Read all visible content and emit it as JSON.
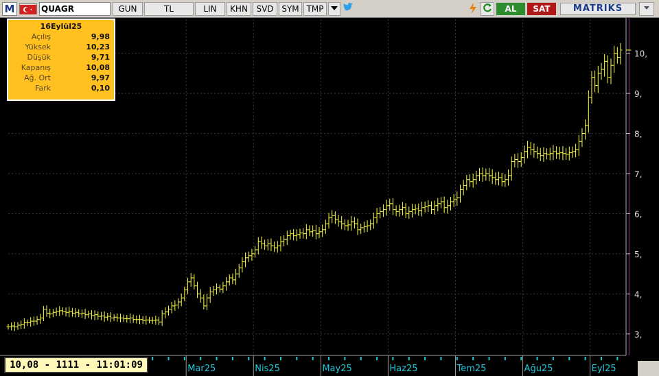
{
  "toolbar": {
    "logo": "M",
    "symbol": "QUAGR",
    "buttons": [
      "GUN",
      "TL",
      "LIN",
      "KHN",
      "SVD",
      "SYM",
      "TMP"
    ],
    "al": "AL",
    "sat": "SAT",
    "brand": "MATRIKS",
    "colors": {
      "al": "#2e8b2e",
      "sat": "#b01818"
    }
  },
  "info": {
    "date": "16Eylül25",
    "rows": [
      {
        "label": "Açılış",
        "value": "9,98"
      },
      {
        "label": "Yüksek",
        "value": "10,23"
      },
      {
        "label": "Düşük",
        "value": "9,71"
      },
      {
        "label": "Kapanış",
        "value": "10,08"
      },
      {
        "label": "Ağ. Ort",
        "value": "9,97"
      },
      {
        "label": "Fark",
        "value": "0,10"
      }
    ]
  },
  "readout": "10,08 - 1111 - 11:01:09",
  "chart_data": {
    "type": "ohlc",
    "color": "#ffff40",
    "ylim": [
      2.5,
      10.85
    ],
    "yticks": [
      3,
      4,
      5,
      6,
      7,
      8,
      9,
      10
    ],
    "ytick_labels": [
      "3,",
      "4,",
      "5,",
      "6,",
      "7,",
      "8,",
      "9,",
      "10,"
    ],
    "month_labels": [
      {
        "label": "Mar25",
        "index": 56
      },
      {
        "label": "Nis25",
        "index": 77
      },
      {
        "label": "May25",
        "index": 98
      },
      {
        "label": "Haz25",
        "index": 119
      },
      {
        "label": "Tem25",
        "index": 140
      },
      {
        "label": "Ağu25",
        "index": 161
      },
      {
        "label": "Eyl25",
        "index": 182
      }
    ],
    "last_index": 193,
    "closes": [
      3.18,
      3.2,
      3.18,
      3.22,
      3.24,
      3.28,
      3.28,
      3.32,
      3.32,
      3.36,
      3.4,
      3.62,
      3.52,
      3.5,
      3.54,
      3.56,
      3.58,
      3.56,
      3.54,
      3.56,
      3.52,
      3.54,
      3.5,
      3.52,
      3.48,
      3.5,
      3.46,
      3.48,
      3.44,
      3.45,
      3.42,
      3.44,
      3.4,
      3.42,
      3.4,
      3.4,
      3.38,
      3.38,
      3.4,
      3.36,
      3.36,
      3.36,
      3.34,
      3.35,
      3.34,
      3.34,
      3.35,
      3.3,
      3.5,
      3.55,
      3.62,
      3.7,
      3.72,
      3.8,
      3.9,
      4.1,
      4.3,
      4.4,
      4.2,
      4.0,
      3.9,
      3.7,
      3.9,
      4.05,
      4.1,
      4.15,
      4.12,
      4.2,
      4.3,
      4.4,
      4.35,
      4.5,
      4.65,
      4.8,
      4.9,
      4.95,
      5.0,
      5.1,
      5.3,
      5.25,
      5.2,
      5.25,
      5.2,
      5.15,
      5.2,
      5.3,
      5.35,
      5.45,
      5.5,
      5.45,
      5.48,
      5.52,
      5.5,
      5.6,
      5.55,
      5.58,
      5.5,
      5.55,
      5.6,
      5.75,
      5.9,
      5.95,
      5.85,
      5.8,
      5.75,
      5.7,
      5.72,
      5.8,
      5.75,
      5.6,
      5.65,
      5.68,
      5.7,
      5.75,
      5.9,
      6.0,
      6.05,
      6.1,
      6.2,
      6.25,
      6.1,
      6.05,
      6.1,
      6.15,
      6.0,
      6.05,
      6.1,
      6.12,
      6.08,
      6.15,
      6.18,
      6.2,
      6.1,
      6.2,
      6.25,
      6.3,
      6.15,
      6.2,
      6.3,
      6.35,
      6.4,
      6.6,
      6.7,
      6.85,
      6.8,
      6.85,
      6.95,
      7.0,
      6.95,
      7.0,
      6.95,
      6.9,
      6.85,
      6.9,
      6.8,
      6.85,
      6.95,
      7.3,
      7.35,
      7.3,
      7.4,
      7.55,
      7.65,
      7.6,
      7.55,
      7.5,
      7.45,
      7.5,
      7.48,
      7.5,
      7.55,
      7.5,
      7.52,
      7.5,
      7.48,
      7.52,
      7.55,
      7.6,
      7.8,
      8.0,
      8.2,
      8.9,
      9.4,
      9.2,
      9.5,
      9.6,
      9.8,
      9.4,
      9.7,
      10.0,
      9.9,
      10.08
    ]
  }
}
